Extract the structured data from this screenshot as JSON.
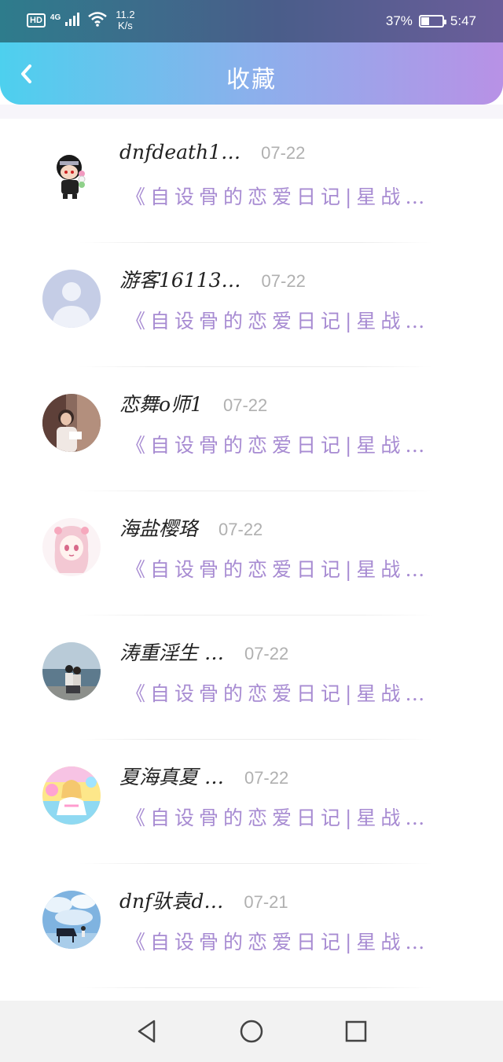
{
  "status_bar": {
    "hd": "HD",
    "network": "4G",
    "speed_value": "11.2",
    "speed_unit": "K/s",
    "battery_percent": "37%",
    "battery_level": 0.37,
    "time": "5:47"
  },
  "header": {
    "title": "收藏",
    "back_icon": "chevron-left-icon"
  },
  "items": [
    {
      "name": "dnfdeath1…",
      "date": "07-22",
      "title": "《自设骨的恋爱日记|星战…",
      "avatar": "chibi-character"
    },
    {
      "name": "游客16113…",
      "date": "07-22",
      "title": "《自设骨的恋爱日记|星战…",
      "avatar": "default-user"
    },
    {
      "name": "恋舞o师1",
      "date": "07-22",
      "title": "《自设骨的恋爱日记|星战…",
      "avatar": "girl-reading-photo"
    },
    {
      "name": "海盐樱珞",
      "date": "07-22",
      "title": "《自设骨的恋爱日记|星战…",
      "avatar": "anime-girl-sketch"
    },
    {
      "name": "涛重淫生 …",
      "date": "07-22",
      "title": "《自设骨的恋爱日记|星战…",
      "avatar": "seaside-couple-photo"
    },
    {
      "name": "夏海真夏 …",
      "date": "07-22",
      "title": "《自设骨的恋爱日记|星战…",
      "avatar": "anime-idol-colorful"
    },
    {
      "name": "dnf驮袁d…",
      "date": "07-21",
      "title": "《自设骨的恋爱日记|星战…",
      "avatar": "piano-sky-art"
    }
  ],
  "nav": {
    "back": "triangle-back-icon",
    "home": "circle-home-icon",
    "recent": "square-recent-icon"
  },
  "colors": {
    "accent_purple": "#a78bd2",
    "header_start": "#4dd0ee",
    "header_end": "#b891e6"
  }
}
